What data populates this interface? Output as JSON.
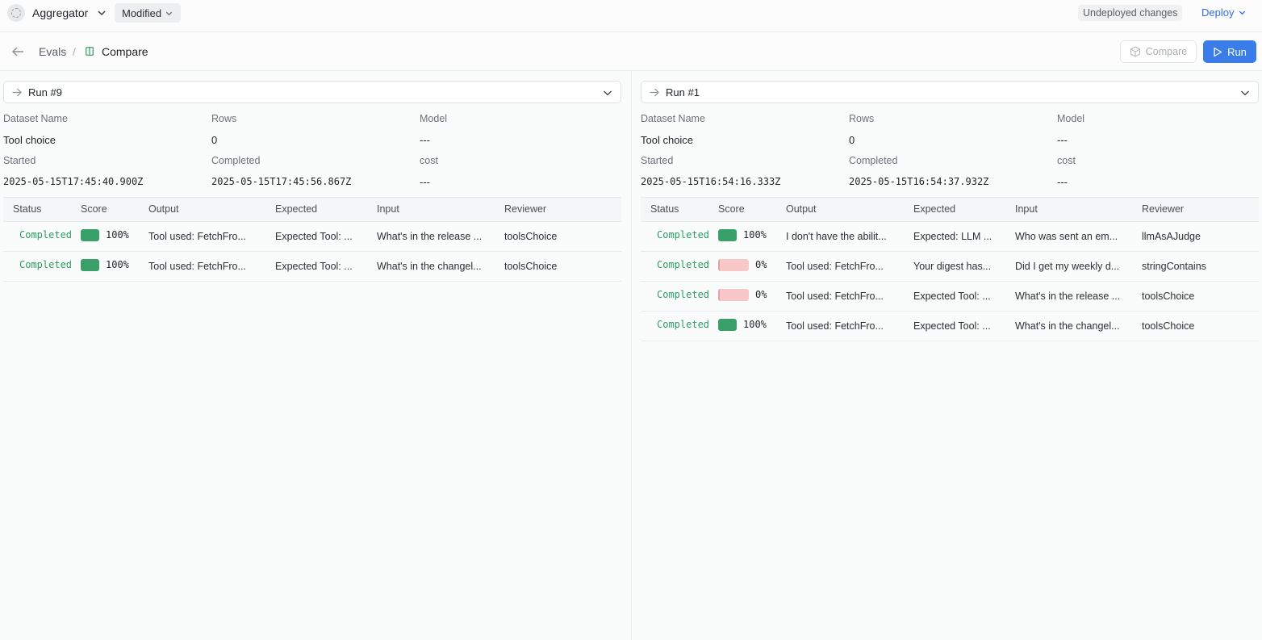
{
  "topbar": {
    "app_name": "Aggregator",
    "modified_label": "Modified",
    "undeployed_label": "Undeployed changes",
    "deploy_label": "Deploy"
  },
  "breadcrumb": {
    "evals": "Evals",
    "separator": "/",
    "current": "Compare"
  },
  "actions": {
    "compare_label": "Compare",
    "run_label": "Run"
  },
  "colors": {
    "accent": "#3b7de8",
    "score_high": "#3aa06a",
    "score_low": "#f8c8c8",
    "status_completed": "#2d9c63"
  },
  "labels": {
    "dataset_name": "Dataset Name",
    "rows": "Rows",
    "model": "Model",
    "started": "Started",
    "completed": "Completed",
    "cost": "cost"
  },
  "columns": [
    "Status",
    "Score",
    "Output",
    "Expected",
    "Input",
    "Reviewer"
  ],
  "left": {
    "run": "Run #9",
    "dataset_name": "Tool choice",
    "rows": "0",
    "model": "---",
    "started": "2025-05-15T17:45:40.900Z",
    "completed": "2025-05-15T17:45:56.867Z",
    "cost": "---",
    "results": [
      {
        "status": "Completed",
        "score": "100%",
        "score_fraction": 1,
        "output_prefix": "Tool used:",
        "output_rest": " FetchFro...",
        "expected_prefix": "Expected Tool:",
        "expected_rest": " ...",
        "input": "What's in the release ...",
        "reviewer": "toolsChoice"
      },
      {
        "status": "Completed",
        "score": "100%",
        "score_fraction": 1,
        "output_prefix": "Tool used:",
        "output_rest": " FetchFro...",
        "expected_prefix": "Expected Tool:",
        "expected_rest": " ...",
        "input": "What's in the changel...",
        "reviewer": "toolsChoice"
      }
    ]
  },
  "right": {
    "run": "Run #1",
    "dataset_name": "Tool choice",
    "rows": "0",
    "model": "---",
    "started": "2025-05-15T16:54:16.333Z",
    "completed": "2025-05-15T16:54:37.932Z",
    "cost": "---",
    "results": [
      {
        "status": "Completed",
        "score": "100%",
        "score_fraction": 1,
        "output_prefix": "",
        "output_rest": "I don't have the abilit...",
        "expected_prefix": "",
        "expected_rest": "Expected: LLM ...",
        "input": "Who was sent an em...",
        "reviewer": "llmAsAJudge"
      },
      {
        "status": "Completed",
        "score": "0%",
        "score_fraction": 0,
        "output_prefix": "Tool used:",
        "output_rest": " FetchFro...",
        "expected_prefix": "",
        "expected_rest": "Your digest has...",
        "input": "Did I get my weekly d...",
        "reviewer": "stringContains"
      },
      {
        "status": "Completed",
        "score": "0%",
        "score_fraction": 0,
        "output_prefix": "Tool used:",
        "output_rest": " FetchFro...",
        "expected_prefix": "Expected Tool:",
        "expected_rest": " ...",
        "input": "What's in the release ...",
        "reviewer": "toolsChoice"
      },
      {
        "status": "Completed",
        "score": "100%",
        "score_fraction": 1,
        "output_prefix": "Tool used:",
        "output_rest": " FetchFro...",
        "expected_prefix": "Expected Tool:",
        "expected_rest": " ...",
        "input": "What's in the changel...",
        "reviewer": "toolsChoice"
      }
    ]
  }
}
